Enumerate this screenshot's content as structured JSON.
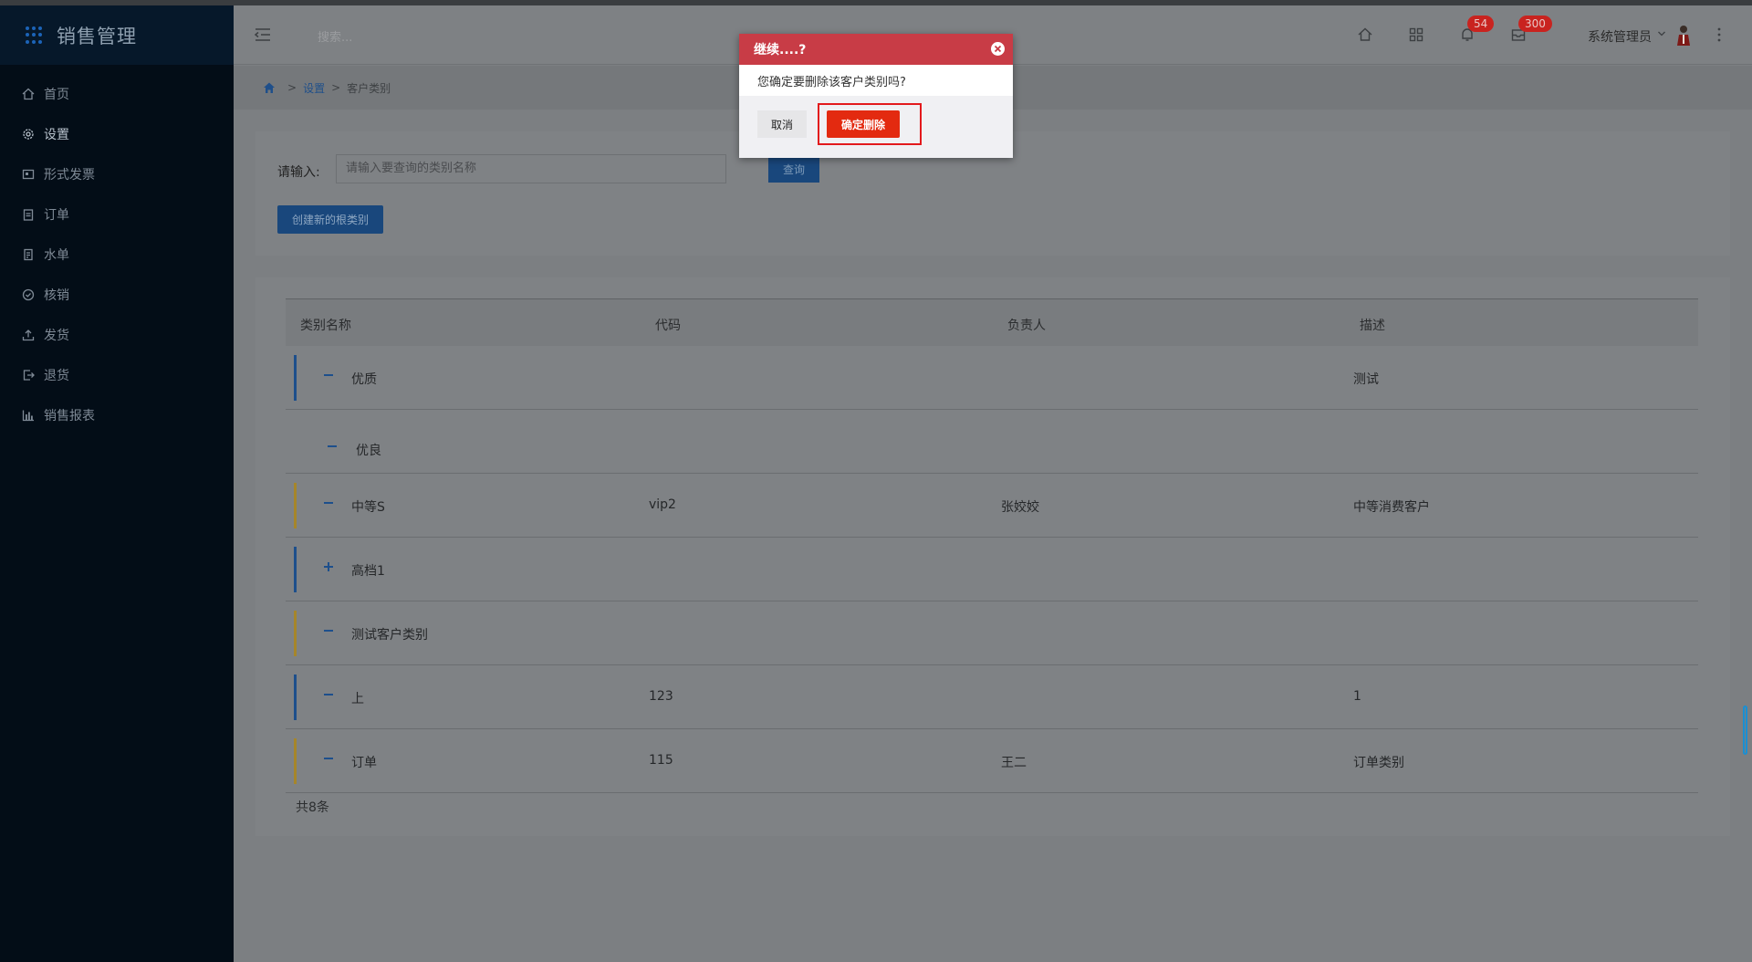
{
  "app": {
    "title": "销售管理"
  },
  "sidebar": {
    "items": [
      {
        "label": "首页",
        "icon": "home-icon"
      },
      {
        "label": "设置",
        "icon": "gear-icon"
      },
      {
        "label": "形式发票",
        "icon": "invoice-icon"
      },
      {
        "label": "订单",
        "icon": "clipboard-icon"
      },
      {
        "label": "水单",
        "icon": "receipt-icon"
      },
      {
        "label": "核销",
        "icon": "check-circle-icon"
      },
      {
        "label": "发货",
        "icon": "upload-icon"
      },
      {
        "label": "退货",
        "icon": "return-icon"
      },
      {
        "label": "销售报表",
        "icon": "bar-chart-icon"
      }
    ],
    "active_index": 1
  },
  "header": {
    "search_placeholder": "搜索...",
    "notifications_count": "54",
    "messages_count": "300",
    "user_name": "系统管理员"
  },
  "breadcrumb": {
    "parent": "设置",
    "current": "客户类别",
    "separator": ">"
  },
  "filter": {
    "label": "请输入:",
    "input_placeholder": "请输入要查询的类别名称",
    "query_button": "查询",
    "create_button": "创建新的根类别"
  },
  "table": {
    "columns": [
      "类别名称",
      "代码",
      "负责人",
      "描述"
    ],
    "rows": [
      {
        "toggle": "−",
        "name": "优质",
        "code": "",
        "owner": "",
        "desc": "测试",
        "bar_color": "#1d4f8c"
      },
      {
        "toggle": "−",
        "name": "优良",
        "code": "",
        "owner": "",
        "desc": "",
        "bar_color": ""
      },
      {
        "toggle": "−",
        "name": "中等S",
        "code": "vip2",
        "owner": "张姣姣",
        "desc": "中等消费客户",
        "bar_color": "#a6862a"
      },
      {
        "toggle": "+",
        "name": "高档1",
        "code": "",
        "owner": "",
        "desc": "",
        "bar_color": "#1d4f8c"
      },
      {
        "toggle": "−",
        "name": "测试客户类别",
        "code": "",
        "owner": "",
        "desc": "",
        "bar_color": "#a6862a"
      },
      {
        "toggle": "−",
        "name": "上",
        "code": "123",
        "owner": "",
        "desc": "1",
        "bar_color": "#1d4f8c"
      },
      {
        "toggle": "−",
        "name": "订单",
        "code": "115",
        "owner": "王二",
        "desc": "订单类别",
        "bar_color": "#a6862a"
      }
    ],
    "total": "共8条"
  },
  "modal": {
    "title": "继续....?",
    "message": "您确定要删除该客户类别吗?",
    "cancel": "取消",
    "confirm": "确定删除"
  }
}
